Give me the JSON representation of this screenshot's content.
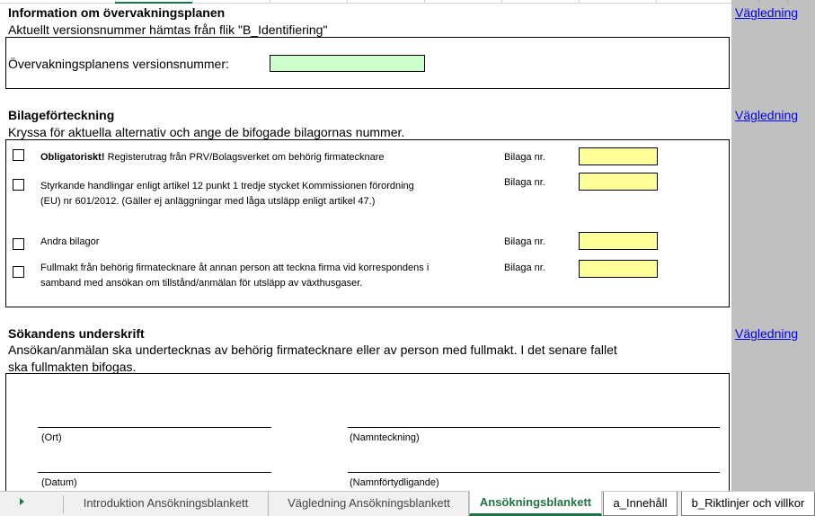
{
  "sections": {
    "info": {
      "heading": "Information om övervakningsplanen",
      "subtitle": "Aktuellt versionsnummer hämtas från flik \"B_Identifiering\"",
      "field_label": "Övervakningsplanens versionsnummer:",
      "field_value": "",
      "guide_link": "Vägledning"
    },
    "attachments": {
      "heading": "Bilageförteckning",
      "subtitle": "Kryssa för aktuella alternativ och ange de bifogade bilagornas nummer.",
      "guide_link": "Vägledning",
      "items": [
        {
          "bold": "Obligatoriskt!",
          "text": "Registerutrag från PRV/Bolagsverket om behörig firmatecknare",
          "label": "Bilaga nr.",
          "value": "",
          "checked": false
        },
        {
          "bold": "",
          "text": "Styrkande handlingar enligt artikel 12 punkt 1 tredje stycket Kommissionen förordning (EU) nr 601/2012. (Gäller ej anläggningar med låga utsläpp enligt artikel 47.)",
          "label": "Bilaga nr.",
          "value": "",
          "checked": false
        },
        {
          "bold": "",
          "text": "Andra bilagor",
          "label": "Bilaga nr.",
          "value": "",
          "checked": false
        },
        {
          "bold": "",
          "text": "Fullmakt från behörig firmatecknare åt annan person att teckna firma vid korrespondens i samband med ansökan om tillstånd/anmälan för utsläpp av växthusgaser.",
          "label": "Bilaga nr.",
          "value": "",
          "checked": false
        }
      ]
    },
    "signature": {
      "heading": "Sökandens underskrift",
      "subtitle_line1": "Ansökan/anmälan ska undertecknas av behörig firmatecknare eller av person med fullmakt. I det senare fallet",
      "subtitle_line2": "ska fullmakten bifogas.",
      "guide_link": "Vägledning",
      "ort_label": "(Ort)",
      "namnteckning_label": "(Namnteckning)",
      "datum_label": "(Datum)",
      "namnfortydligande_label": "(Namnförtydligande)"
    }
  },
  "tabs": [
    {
      "label": "Introduktion Ansökningsblankett",
      "active": false
    },
    {
      "label": "Vägledning Ansökningsblankett",
      "active": false
    },
    {
      "label": "Ansökningsblankett",
      "active": true
    },
    {
      "label": "a_Innehåll",
      "active": false
    },
    {
      "label": "b_Riktlinjer och villkor",
      "active": false
    }
  ],
  "colors": {
    "green_input": "#ccffcc",
    "yellow_input": "#ffff99",
    "link": "#0000ee",
    "excel_green": "#217346",
    "margin_gray": "#c0c0c0"
  }
}
